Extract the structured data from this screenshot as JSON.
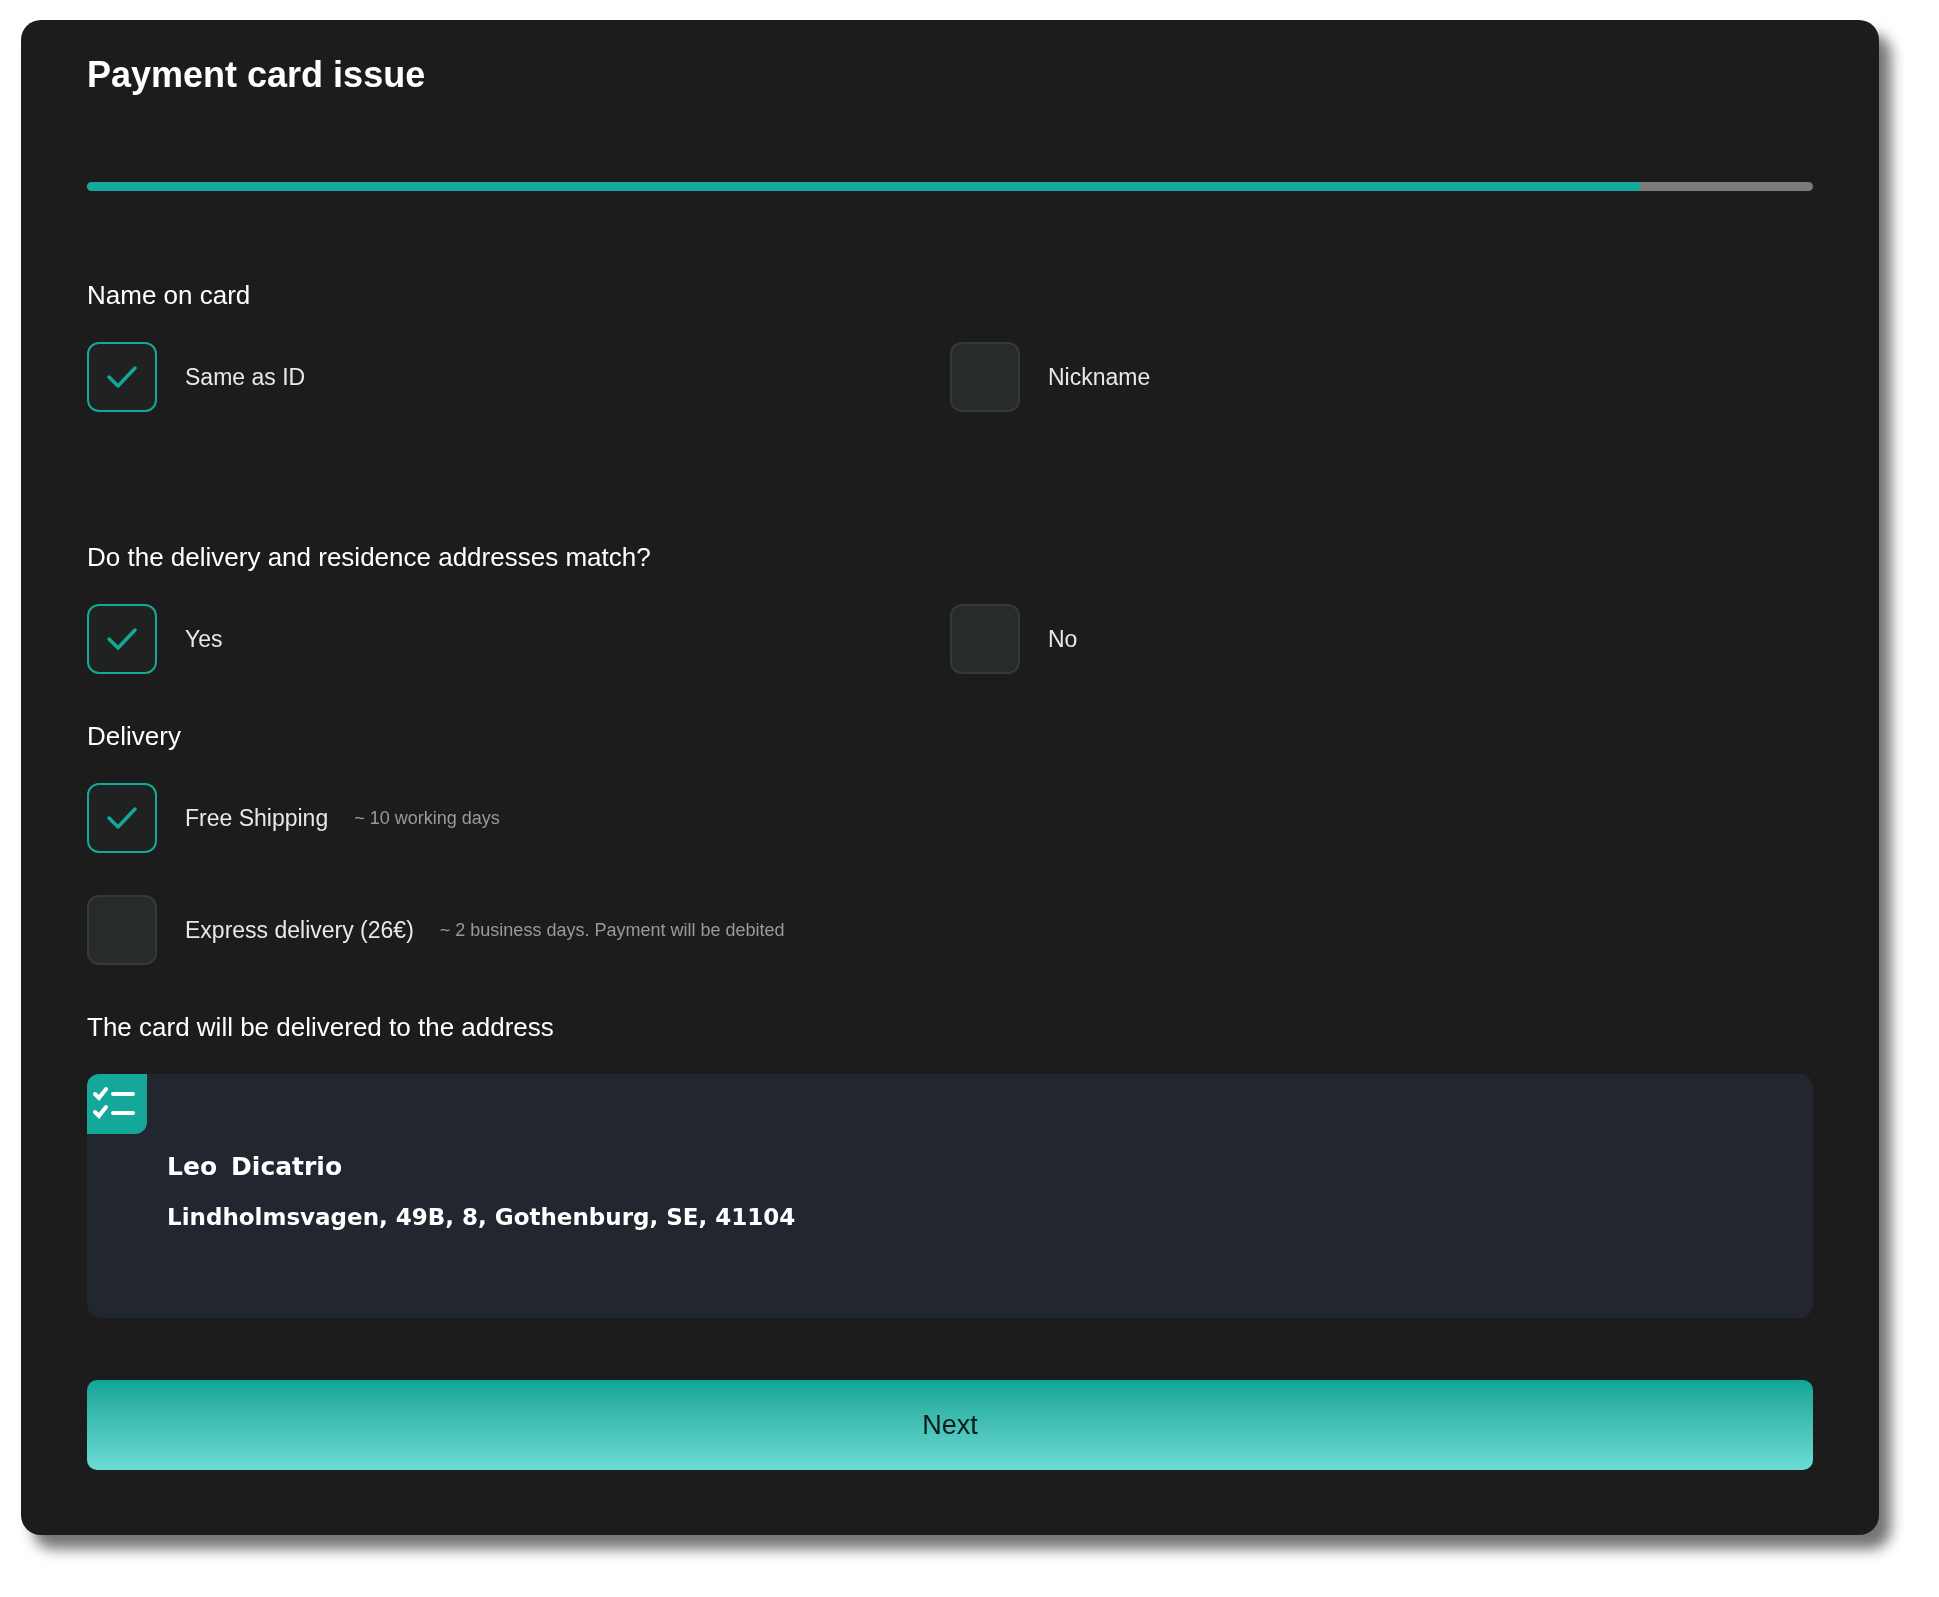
{
  "title": "Payment card issue",
  "progress": {
    "level": 0.9
  },
  "sections": [
    {
      "label": "Name on card",
      "kind": "columns",
      "options": [
        {
          "label": "Same as ID",
          "checked": true
        },
        {
          "label": "Nickname",
          "checked": false
        }
      ]
    },
    {
      "label": "Do the delivery and residence addresses match?",
      "kind": "columns",
      "options": [
        {
          "label": "Yes",
          "checked": true
        },
        {
          "label": "No",
          "checked": false
        }
      ]
    },
    {
      "label": "Delivery",
      "kind": "stacked",
      "options": [
        {
          "label": "Free Shipping",
          "hint": "~ 10 working days",
          "checked": true
        },
        {
          "label": "Express delivery (26€)",
          "hint": "~ 2 business days. Payment will be debited",
          "checked": false
        }
      ]
    }
  ],
  "address": {
    "label": "The card will be delivered to the address",
    "first_name": "Leo",
    "last_name": "Dicatrio",
    "line": "Lindholmsvagen, 49B, 8, Gothenburg, SE, 41104"
  },
  "button": {
    "label": "Next"
  }
}
